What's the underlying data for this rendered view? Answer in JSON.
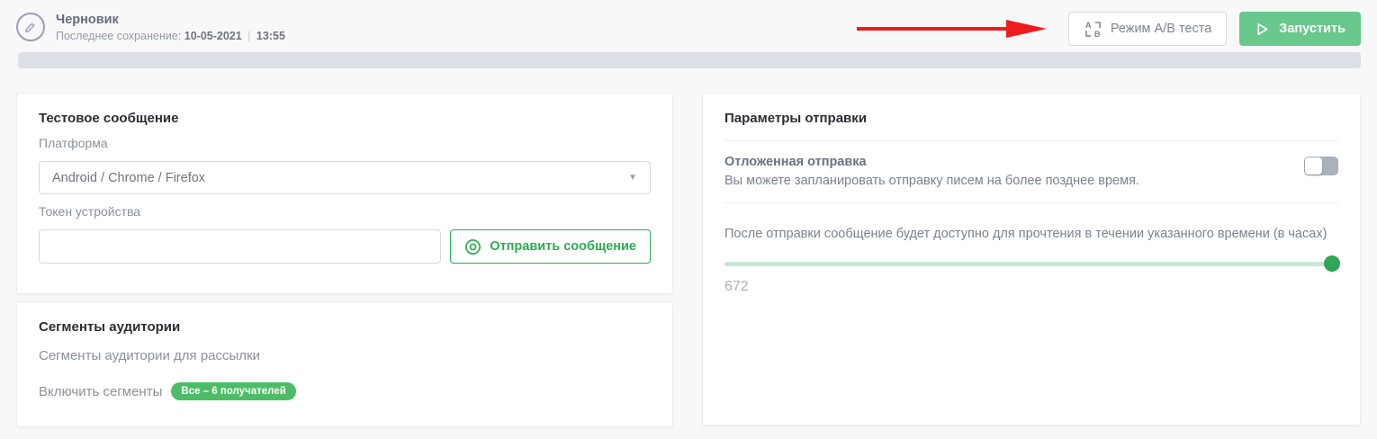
{
  "header": {
    "title": "Черновик",
    "last_save_label": "Последнее сохранение:",
    "last_save_date": "10-05-2021",
    "last_save_separator": "|",
    "last_save_time": "13:55",
    "ab_test_button_label": "Режим А/В теста",
    "launch_button_label": "Запустить"
  },
  "progress": {
    "value_percent": 0
  },
  "test_message": {
    "title": "Тестовое сообщение",
    "platform_label": "Платформа",
    "platform_value": "Android / Chrome / Firefox",
    "token_label": "Токен устройства",
    "token_value": "",
    "send_button_label": "Отправить сообщение"
  },
  "segments": {
    "title": "Сегменты аудитории",
    "subtitle": "Сегменты аудитории для рассылки",
    "include_label": "Включить сегменты",
    "badge_label": "Все – 6 получателей"
  },
  "send_params": {
    "title": "Параметры отправки",
    "delayed_title": "Отложенная отправка",
    "delayed_description": "Вы можете запланировать отправку писем на более позднее время.",
    "delayed_enabled": false,
    "ttl_label": "После отправки сообщение будет доступно для прочтения в течении указанного времени (в часах)",
    "ttl_value": "672",
    "ttl_slider_percent": 100
  },
  "colors": {
    "launch_green": "#69c88c",
    "outline_green": "#2aae54",
    "badge_green": "#4cbd66",
    "slider_knob_green": "#32a457",
    "slider_track_green": "#c9e6d5",
    "arrow_red": "#ee1d1d",
    "progress_gray": "#dce0e6"
  }
}
